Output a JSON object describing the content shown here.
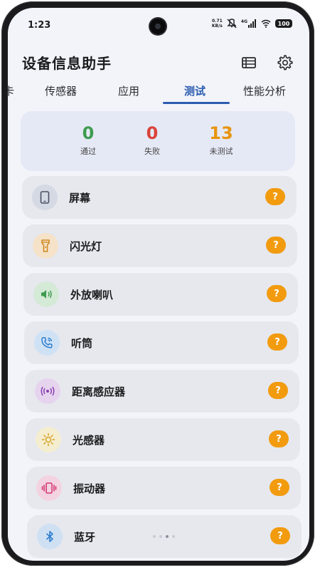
{
  "status_bar": {
    "time": "1:23",
    "net_speed_value": "0.71",
    "net_speed_unit": "KB/s",
    "signal_label": "4G",
    "battery": "100"
  },
  "app_bar": {
    "title": "设备信息助手",
    "icons": [
      "list-icon",
      "gear-icon"
    ]
  },
  "tabs": [
    {
      "label": "卡",
      "active": false
    },
    {
      "label": "传感器",
      "active": false
    },
    {
      "label": "应用",
      "active": false
    },
    {
      "label": "测试",
      "active": true
    },
    {
      "label": "性能分析",
      "active": false
    }
  ],
  "summary": {
    "passed": {
      "value": "0",
      "label": "通过",
      "color": "#3f9b4f"
    },
    "failed": {
      "value": "0",
      "label": "失败",
      "color": "#d9433b"
    },
    "untested": {
      "value": "13",
      "label": "未测试",
      "color": "#e89410"
    }
  },
  "tests": [
    {
      "label": "屏幕",
      "icon": "phone-screen-icon",
      "icon_bg": "#d4d9e4",
      "icon_color": "#4a5064",
      "status": "?"
    },
    {
      "label": "闪光灯",
      "icon": "flashlight-icon",
      "icon_bg": "#f5e2c9",
      "icon_color": "#d08a22",
      "status": "?"
    },
    {
      "label": "外放喇叭",
      "icon": "speaker-icon",
      "icon_bg": "#d4ead6",
      "icon_color": "#3f9b4f",
      "status": "?"
    },
    {
      "label": "听筒",
      "icon": "phone-call-icon",
      "icon_bg": "#cfe2f5",
      "icon_color": "#2f7fd0",
      "status": "?"
    },
    {
      "label": "距离感应器",
      "icon": "proximity-icon",
      "icon_bg": "#e6d4ee",
      "icon_color": "#8b3fb0",
      "status": "?"
    },
    {
      "label": "光感器",
      "icon": "sun-icon",
      "icon_bg": "#f5edd0",
      "icon_color": "#d7a322",
      "status": "?"
    },
    {
      "label": "振动器",
      "icon": "vibrate-icon",
      "icon_bg": "#f3d3e0",
      "icon_color": "#d2386f",
      "status": "?"
    },
    {
      "label": "蓝牙",
      "icon": "bluetooth-icon",
      "icon_bg": "#cfe0f3",
      "icon_color": "#2f7fd0",
      "status": "?"
    }
  ]
}
